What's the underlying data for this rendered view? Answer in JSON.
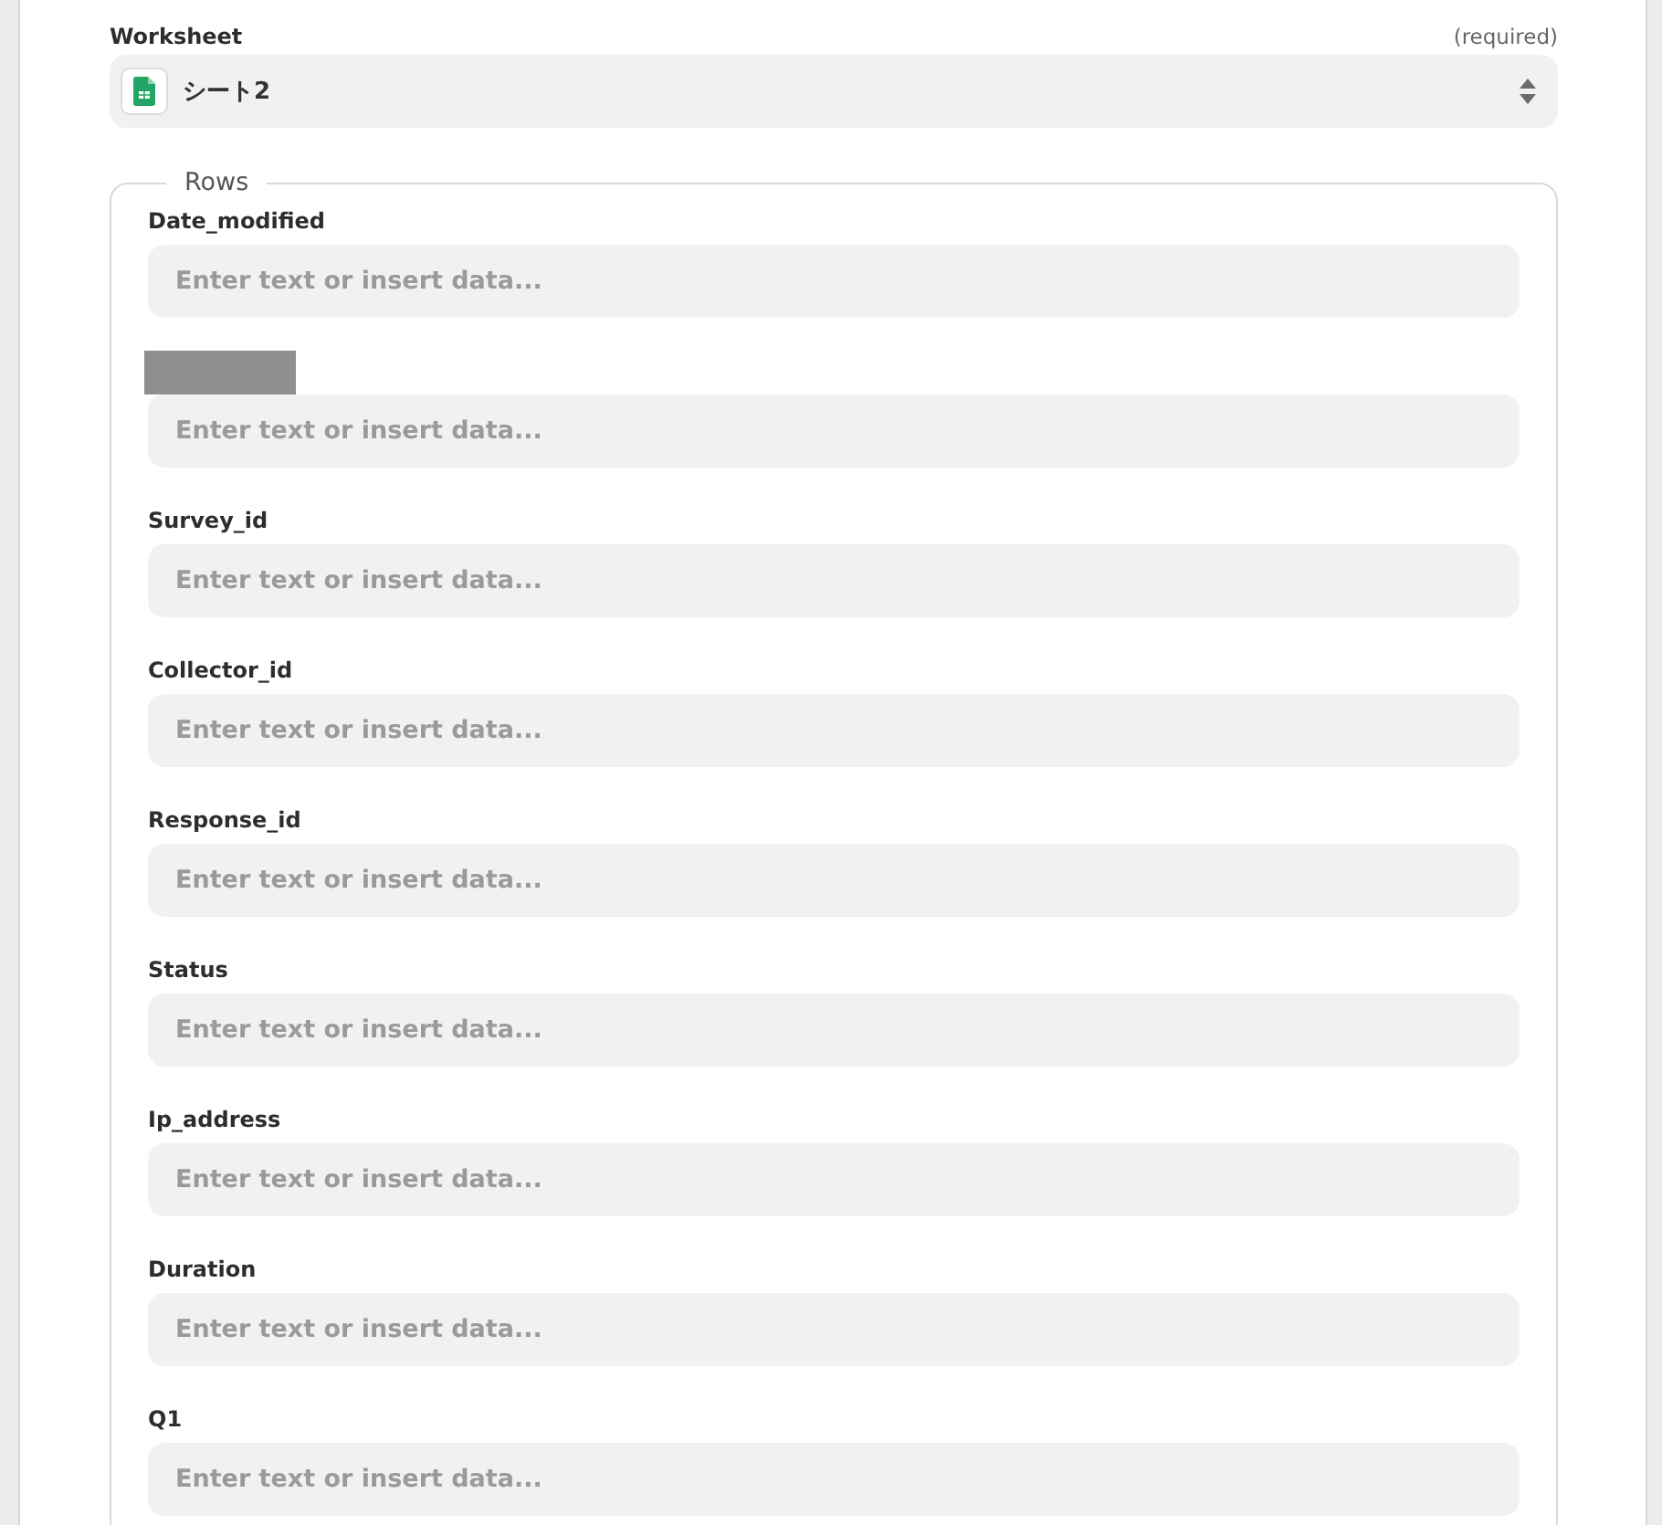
{
  "worksheet": {
    "label": "Worksheet",
    "required": "(required)",
    "value": "シート2"
  },
  "rows": {
    "legend": "Rows",
    "fields": [
      {
        "kind": "labeled",
        "label": "Date_modified",
        "placeholder": "Enter text or insert data..."
      },
      {
        "kind": "redacted",
        "placeholder": "Enter text or insert data..."
      },
      {
        "kind": "labeled",
        "label": "Survey_id",
        "placeholder": "Enter text or insert data..."
      },
      {
        "kind": "labeled",
        "label": "Collector_id",
        "placeholder": "Enter text or insert data..."
      },
      {
        "kind": "labeled",
        "label": "Response_id",
        "placeholder": "Enter text or insert data..."
      },
      {
        "kind": "labeled",
        "label": "Status",
        "placeholder": "Enter text or insert data..."
      },
      {
        "kind": "labeled",
        "label": "Ip_address",
        "placeholder": "Enter text or insert data..."
      },
      {
        "kind": "labeled",
        "label": "Duration",
        "placeholder": "Enter text or insert data..."
      },
      {
        "kind": "labeled",
        "label": "Q1",
        "placeholder": "Enter text or insert data..."
      }
    ]
  }
}
